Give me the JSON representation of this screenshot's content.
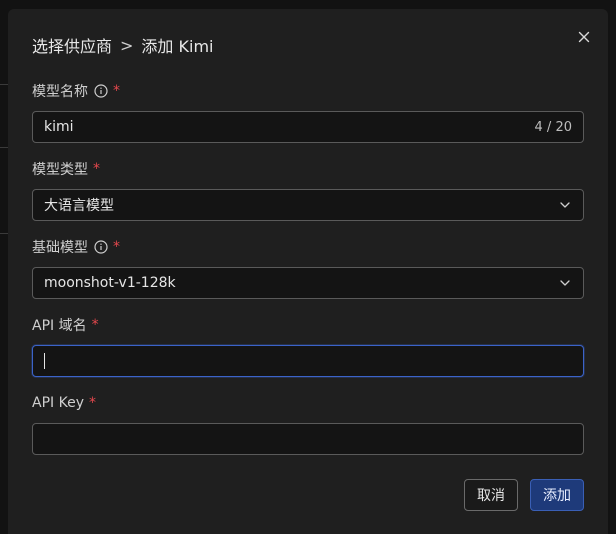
{
  "header": {
    "breadcrumb_parent": "选择供应商",
    "separator": ">",
    "title": "添加 Kimi"
  },
  "fields": {
    "model_name": {
      "label": "模型名称",
      "required_mark": "*",
      "value": "kimi",
      "counter": "4 / 20"
    },
    "model_type": {
      "label": "模型类型",
      "required_mark": "*",
      "value": "大语言模型"
    },
    "base_model": {
      "label": "基础模型",
      "required_mark": "*",
      "value": "moonshot-v1-128k"
    },
    "api_domain": {
      "label": "API 域名",
      "required_mark": "*",
      "value": ""
    },
    "api_key": {
      "label": "API Key",
      "required_mark": "*",
      "value": ""
    }
  },
  "footer": {
    "cancel_label": "取消",
    "submit_label": "添加"
  },
  "colors": {
    "accent": "#1e3a7a",
    "focus_border": "#3b63c9",
    "required": "#e5484d"
  },
  "icons": [
    "close-icon",
    "info-icon",
    "chevron-down-icon"
  ]
}
